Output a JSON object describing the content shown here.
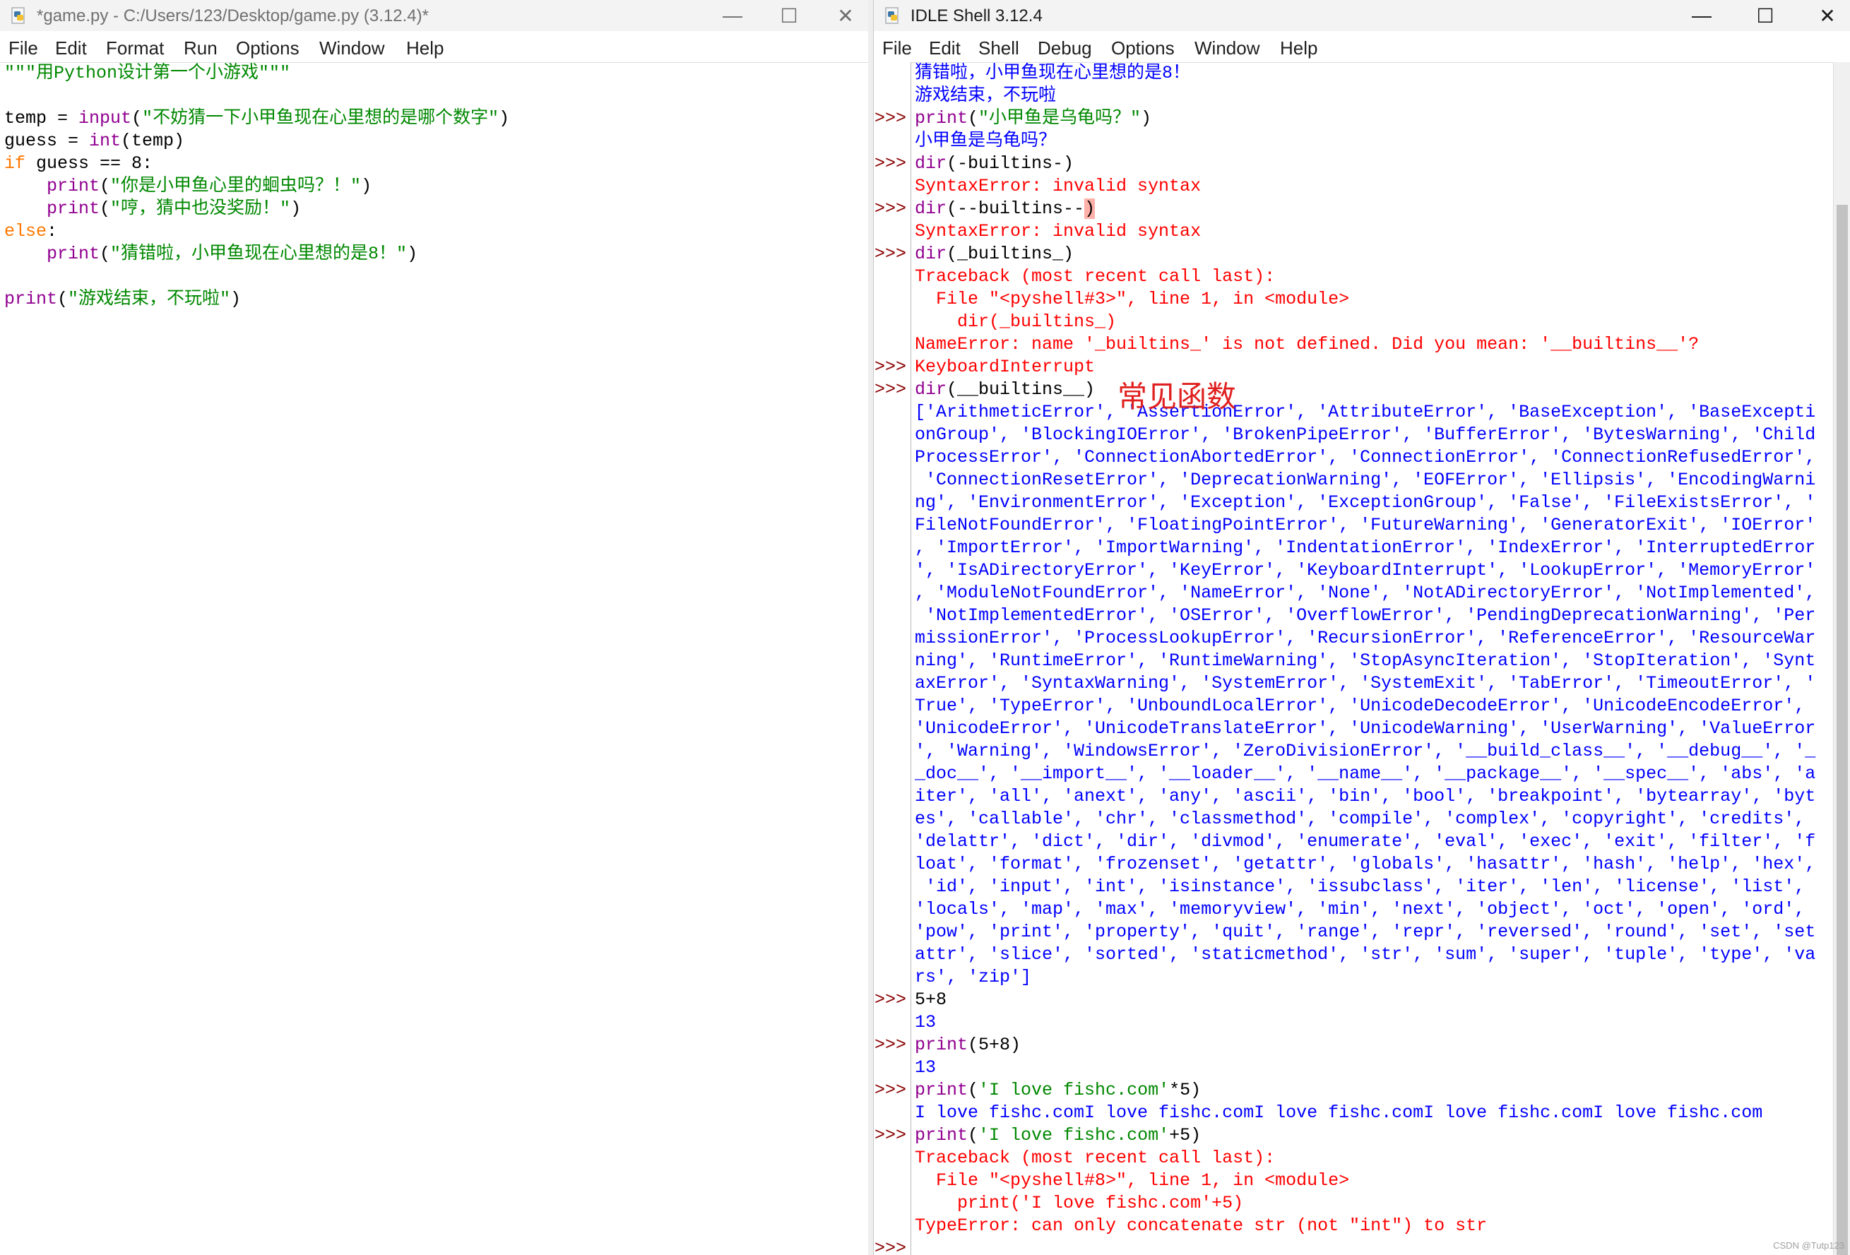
{
  "editor": {
    "title": "*game.py - C:/Users/123/Desktop/game.py (3.12.4)*",
    "icon": "python-file-icon",
    "menu": [
      "File",
      "Edit",
      "Format",
      "Run",
      "Options",
      "Window",
      "Help"
    ],
    "controls": {
      "minimize": "—",
      "maximize": "☐",
      "close": "✕"
    },
    "lines": [
      [
        {
          "c": "str",
          "t": "\"\"\"用Python设计第一个小游戏\"\"\""
        }
      ],
      [],
      [
        {
          "c": "plain",
          "t": "temp = "
        },
        {
          "c": "bi",
          "t": "input"
        },
        {
          "c": "plain",
          "t": "("
        },
        {
          "c": "str",
          "t": "\"不妨猜一下小甲鱼现在心里想的是哪个数字\""
        },
        {
          "c": "plain",
          "t": ")"
        }
      ],
      [
        {
          "c": "plain",
          "t": "guess = "
        },
        {
          "c": "bi",
          "t": "int"
        },
        {
          "c": "plain",
          "t": "(temp)"
        }
      ],
      [
        {
          "c": "kw",
          "t": "if"
        },
        {
          "c": "plain",
          "t": " guess == 8:"
        }
      ],
      [
        {
          "c": "plain",
          "t": "    "
        },
        {
          "c": "bi",
          "t": "print"
        },
        {
          "c": "plain",
          "t": "("
        },
        {
          "c": "str",
          "t": "\"你是小甲鱼心里的蛔虫吗？！\""
        },
        {
          "c": "plain",
          "t": ")"
        }
      ],
      [
        {
          "c": "plain",
          "t": "    "
        },
        {
          "c": "bi",
          "t": "print"
        },
        {
          "c": "plain",
          "t": "("
        },
        {
          "c": "str",
          "t": "\"哼，猜中也没奖励！\""
        },
        {
          "c": "plain",
          "t": ")"
        }
      ],
      [
        {
          "c": "kw",
          "t": "else"
        },
        {
          "c": "plain",
          "t": ":"
        }
      ],
      [
        {
          "c": "plain",
          "t": "    "
        },
        {
          "c": "bi",
          "t": "print"
        },
        {
          "c": "plain",
          "t": "("
        },
        {
          "c": "str",
          "t": "\"猜错啦，小甲鱼现在心里想的是8！\""
        },
        {
          "c": "plain",
          "t": ")"
        }
      ],
      [],
      [
        {
          "c": "bi",
          "t": "print"
        },
        {
          "c": "plain",
          "t": "("
        },
        {
          "c": "str",
          "t": "\"游戏结束，不玩啦\""
        },
        {
          "c": "plain",
          "t": ")"
        }
      ]
    ]
  },
  "shell": {
    "title": "IDLE Shell 3.12.4",
    "icon": "python-shell-icon",
    "menu": [
      "File",
      "Edit",
      "Shell",
      "Debug",
      "Options",
      "Window",
      "Help"
    ],
    "controls": {
      "minimize": "—",
      "maximize": "☐",
      "close": "✕"
    },
    "prompt": ">>>",
    "lines": [
      {
        "p": false,
        "segs": [
          {
            "c": "out",
            "t": "猜错啦，小甲鱼现在心里想的是8！"
          }
        ]
      },
      {
        "p": false,
        "segs": [
          {
            "c": "out",
            "t": "游戏结束，不玩啦"
          }
        ]
      },
      {
        "p": true,
        "segs": [
          {
            "c": "bi",
            "t": "print"
          },
          {
            "c": "plain",
            "t": "("
          },
          {
            "c": "str",
            "t": "\"小甲鱼是乌龟吗？\""
          },
          {
            "c": "plain",
            "t": ")"
          }
        ]
      },
      {
        "p": false,
        "segs": [
          {
            "c": "out",
            "t": "小甲鱼是乌龟吗？"
          }
        ]
      },
      {
        "p": true,
        "segs": [
          {
            "c": "bi",
            "t": "dir"
          },
          {
            "c": "plain",
            "t": "(-builtins-)"
          }
        ]
      },
      {
        "p": false,
        "segs": [
          {
            "c": "err",
            "t": "SyntaxError: invalid syntax"
          }
        ]
      },
      {
        "p": true,
        "segs": [
          {
            "c": "bi",
            "t": "dir"
          },
          {
            "c": "plain",
            "t": "(--builtins--"
          },
          {
            "c": "hl",
            "t": ")"
          }
        ]
      },
      {
        "p": false,
        "segs": [
          {
            "c": "err",
            "t": "SyntaxError: invalid syntax"
          }
        ]
      },
      {
        "p": true,
        "segs": [
          {
            "c": "bi",
            "t": "dir"
          },
          {
            "c": "plain",
            "t": "(_builtins_)"
          }
        ]
      },
      {
        "p": false,
        "segs": [
          {
            "c": "err",
            "t": "Traceback (most recent call last):"
          }
        ]
      },
      {
        "p": false,
        "segs": [
          {
            "c": "err",
            "t": "  File \"<pyshell#3>\", line 1, in <module>"
          }
        ]
      },
      {
        "p": false,
        "segs": [
          {
            "c": "err",
            "t": "    dir(_builtins_)"
          }
        ]
      },
      {
        "p": false,
        "segs": [
          {
            "c": "err",
            "t": "NameError: name '_builtins_' is not defined. Did you mean: '__builtins__'?"
          }
        ]
      },
      {
        "p": true,
        "segs": [
          {
            "c": "err",
            "t": "KeyboardInterrupt"
          }
        ]
      },
      {
        "p": true,
        "segs": [
          {
            "c": "bi",
            "t": "dir"
          },
          {
            "c": "plain",
            "t": "(__builtins__)"
          }
        ]
      },
      {
        "p": false,
        "segs": [
          {
            "c": "out",
            "t": "['ArithmeticError', 'AssertionError', 'AttributeError', 'BaseException', 'BaseExcepti"
          }
        ]
      },
      {
        "p": false,
        "segs": [
          {
            "c": "out",
            "t": "onGroup', 'BlockingIOError', 'BrokenPipeError', 'BufferError', 'BytesWarning', 'Child"
          }
        ]
      },
      {
        "p": false,
        "segs": [
          {
            "c": "out",
            "t": "ProcessError', 'ConnectionAbortedError', 'ConnectionError', 'ConnectionRefusedError',"
          }
        ]
      },
      {
        "p": false,
        "segs": [
          {
            "c": "out",
            "t": " 'ConnectionResetError', 'DeprecationWarning', 'EOFError', 'Ellipsis', 'EncodingWarni"
          }
        ]
      },
      {
        "p": false,
        "segs": [
          {
            "c": "out",
            "t": "ng', 'EnvironmentError', 'Exception', 'ExceptionGroup', 'False', 'FileExistsError', '"
          }
        ]
      },
      {
        "p": false,
        "segs": [
          {
            "c": "out",
            "t": "FileNotFoundError', 'FloatingPointError', 'FutureWarning', 'GeneratorExit', 'IOError'"
          }
        ]
      },
      {
        "p": false,
        "segs": [
          {
            "c": "out",
            "t": ", 'ImportError', 'ImportWarning', 'IndentationError', 'IndexError', 'InterruptedError"
          }
        ]
      },
      {
        "p": false,
        "segs": [
          {
            "c": "out",
            "t": "', 'IsADirectoryError', 'KeyError', 'KeyboardInterrupt', 'LookupError', 'MemoryError'"
          }
        ]
      },
      {
        "p": false,
        "segs": [
          {
            "c": "out",
            "t": ", 'ModuleNotFoundError', 'NameError', 'None', 'NotADirectoryError', 'NotImplemented',"
          }
        ]
      },
      {
        "p": false,
        "segs": [
          {
            "c": "out",
            "t": " 'NotImplementedError', 'OSError', 'OverflowError', 'PendingDeprecationWarning', 'Per"
          }
        ]
      },
      {
        "p": false,
        "segs": [
          {
            "c": "out",
            "t": "missionError', 'ProcessLookupError', 'RecursionError', 'ReferenceError', 'ResourceWar"
          }
        ]
      },
      {
        "p": false,
        "segs": [
          {
            "c": "out",
            "t": "ning', 'RuntimeError', 'RuntimeWarning', 'StopAsyncIteration', 'StopIteration', 'Synt"
          }
        ]
      },
      {
        "p": false,
        "segs": [
          {
            "c": "out",
            "t": "axError', 'SyntaxWarning', 'SystemError', 'SystemExit', 'TabError', 'TimeoutError', '"
          }
        ]
      },
      {
        "p": false,
        "segs": [
          {
            "c": "out",
            "t": "True', 'TypeError', 'UnboundLocalError', 'UnicodeDecodeError', 'UnicodeEncodeError',"
          }
        ]
      },
      {
        "p": false,
        "segs": [
          {
            "c": "out",
            "t": "'UnicodeError', 'UnicodeTranslateError', 'UnicodeWarning', 'UserWarning', 'ValueError"
          }
        ]
      },
      {
        "p": false,
        "segs": [
          {
            "c": "out",
            "t": "', 'Warning', 'WindowsError', 'ZeroDivisionError', '__build_class__', '__debug__', '_"
          }
        ]
      },
      {
        "p": false,
        "segs": [
          {
            "c": "out",
            "t": "_doc__', '__import__', '__loader__', '__name__', '__package__', '__spec__', 'abs', 'a"
          }
        ]
      },
      {
        "p": false,
        "segs": [
          {
            "c": "out",
            "t": "iter', 'all', 'anext', 'any', 'ascii', 'bin', 'bool', 'breakpoint', 'bytearray', 'byt"
          }
        ]
      },
      {
        "p": false,
        "segs": [
          {
            "c": "out",
            "t": "es', 'callable', 'chr', 'classmethod', 'compile', 'complex', 'copyright', 'credits',"
          }
        ]
      },
      {
        "p": false,
        "segs": [
          {
            "c": "out",
            "t": "'delattr', 'dict', 'dir', 'divmod', 'enumerate', 'eval', 'exec', 'exit', 'filter', 'f"
          }
        ]
      },
      {
        "p": false,
        "segs": [
          {
            "c": "out",
            "t": "loat', 'format', 'frozenset', 'getattr', 'globals', 'hasattr', 'hash', 'help', 'hex',"
          }
        ]
      },
      {
        "p": false,
        "segs": [
          {
            "c": "out",
            "t": " 'id', 'input', 'int', 'isinstance', 'issubclass', 'iter', 'len', 'license', 'list',"
          }
        ]
      },
      {
        "p": false,
        "segs": [
          {
            "c": "out",
            "t": "'locals', 'map', 'max', 'memoryview', 'min', 'next', 'object', 'oct', 'open', 'ord',"
          }
        ]
      },
      {
        "p": false,
        "segs": [
          {
            "c": "out",
            "t": "'pow', 'print', 'property', 'quit', 'range', 'repr', 'reversed', 'round', 'set', 'set"
          }
        ]
      },
      {
        "p": false,
        "segs": [
          {
            "c": "out",
            "t": "attr', 'slice', 'sorted', 'staticmethod', 'str', 'sum', 'super', 'tuple', 'type', 'va"
          }
        ]
      },
      {
        "p": false,
        "segs": [
          {
            "c": "out",
            "t": "rs', 'zip']"
          }
        ]
      },
      {
        "p": true,
        "segs": [
          {
            "c": "plain",
            "t": "5+8"
          }
        ]
      },
      {
        "p": false,
        "segs": [
          {
            "c": "out",
            "t": "13"
          }
        ]
      },
      {
        "p": true,
        "segs": [
          {
            "c": "bi",
            "t": "print"
          },
          {
            "c": "plain",
            "t": "(5+8)"
          }
        ]
      },
      {
        "p": false,
        "segs": [
          {
            "c": "out",
            "t": "13"
          }
        ]
      },
      {
        "p": true,
        "segs": [
          {
            "c": "bi",
            "t": "print"
          },
          {
            "c": "plain",
            "t": "("
          },
          {
            "c": "str",
            "t": "'I love fishc.com'"
          },
          {
            "c": "plain",
            "t": "*5)"
          }
        ]
      },
      {
        "p": false,
        "segs": [
          {
            "c": "out",
            "t": "I love fishc.comI love fishc.comI love fishc.comI love fishc.comI love fishc.com"
          }
        ]
      },
      {
        "p": true,
        "segs": [
          {
            "c": "bi",
            "t": "print"
          },
          {
            "c": "plain",
            "t": "("
          },
          {
            "c": "str",
            "t": "'I love fishc.com'"
          },
          {
            "c": "plain",
            "t": "+5)"
          }
        ]
      },
      {
        "p": false,
        "segs": [
          {
            "c": "err",
            "t": "Traceback (most recent call last):"
          }
        ]
      },
      {
        "p": false,
        "segs": [
          {
            "c": "err",
            "t": "  File \"<pyshell#8>\", line 1, in <module>"
          }
        ]
      },
      {
        "p": false,
        "segs": [
          {
            "c": "err",
            "t": "    print('I love fishc.com'+5)"
          }
        ]
      },
      {
        "p": false,
        "segs": [
          {
            "c": "err",
            "t": "TypeError: can only concatenate str (not \"int\") to str"
          }
        ]
      },
      {
        "p": true,
        "segs": []
      }
    ]
  },
  "annotation": "常见函数",
  "watermark": "CSDN @Tutp123",
  "colors": {
    "string": "#008800",
    "keyword": "#ff7700",
    "builtin": "#900090",
    "output": "#0000ff",
    "error": "#ff0000",
    "prompt": "#8a0000"
  }
}
